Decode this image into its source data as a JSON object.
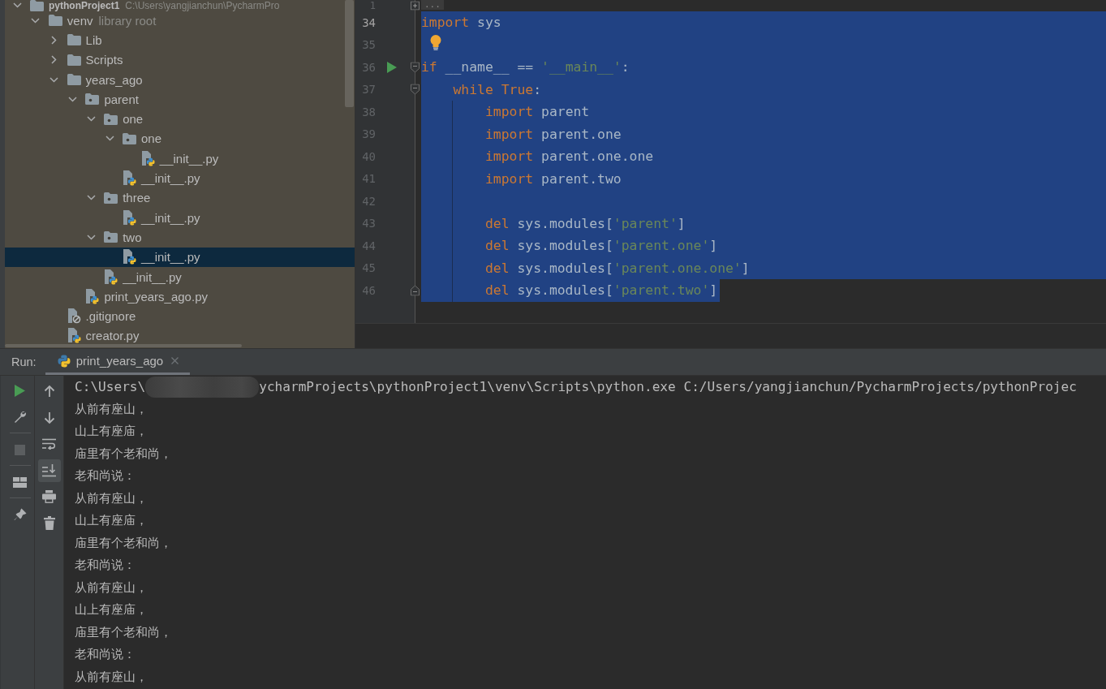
{
  "project_tree": {
    "root": {
      "label": "pythonProject1",
      "path": "C:\\Users\\yangjianchun\\PycharmPro",
      "kind": "project",
      "expanded": true,
      "selected": false,
      "children": [
        {
          "label": "venv",
          "note": "library root",
          "kind": "folder",
          "expanded": true,
          "selected": false,
          "children": [
            {
              "label": "Lib",
              "kind": "folder",
              "expanded": false,
              "selected": false
            },
            {
              "label": "Scripts",
              "kind": "folder",
              "expanded": false,
              "selected": false
            },
            {
              "label": "years_ago",
              "kind": "folder",
              "expanded": true,
              "selected": false,
              "children": [
                {
                  "label": "parent",
                  "kind": "package",
                  "expanded": true,
                  "selected": false,
                  "children": [
                    {
                      "label": "one",
                      "kind": "package",
                      "expanded": true,
                      "selected": false,
                      "children": [
                        {
                          "label": "one",
                          "kind": "package",
                          "expanded": true,
                          "selected": false,
                          "children": [
                            {
                              "label": "__init__.py",
                              "kind": "python",
                              "selected": false
                            }
                          ]
                        },
                        {
                          "label": "__init__.py",
                          "kind": "python",
                          "selected": false
                        }
                      ]
                    },
                    {
                      "label": "three",
                      "kind": "package",
                      "expanded": true,
                      "selected": false,
                      "children": [
                        {
                          "label": "__init__.py",
                          "kind": "python",
                          "selected": false
                        }
                      ]
                    },
                    {
                      "label": "two",
                      "kind": "package",
                      "expanded": true,
                      "selected": false,
                      "children": [
                        {
                          "label": "__init__.py",
                          "kind": "python",
                          "selected": true
                        }
                      ]
                    },
                    {
                      "label": "__init__.py",
                      "kind": "python",
                      "selected": false
                    }
                  ]
                },
                {
                  "label": "print_years_ago.py",
                  "kind": "python",
                  "selected": false
                }
              ]
            },
            {
              "label": ".gitignore",
              "kind": "ignore",
              "selected": false
            },
            {
              "label": "creator.py",
              "kind": "python",
              "selected": false
            }
          ]
        }
      ]
    }
  },
  "editor": {
    "lines": [
      {
        "number": "1",
        "current": false,
        "selected": false,
        "fold": {
          "kind": "folded"
        },
        "folded_text": "..."
      },
      {
        "number": "34",
        "current": true,
        "selected": true,
        "tokens": [
          {
            "text": "import",
            "kind": "keyword"
          },
          {
            "text": " sys",
            "kind": "plain"
          }
        ]
      },
      {
        "number": "35",
        "current": false,
        "selected": true,
        "marker": {
          "kind": "bulb"
        }
      },
      {
        "number": "36",
        "current": false,
        "selected": true,
        "marker": {
          "kind": "run"
        },
        "fold": {
          "kind": "start"
        },
        "tokens": [
          {
            "text": "if",
            "kind": "keyword"
          },
          {
            "text": " __name__ == ",
            "kind": "plain"
          },
          {
            "text": "'__main__'",
            "kind": "string"
          },
          {
            "text": ":",
            "kind": "plain"
          }
        ]
      },
      {
        "number": "37",
        "current": false,
        "selected": true,
        "fold": {
          "kind": "start"
        },
        "tokens": [
          {
            "text": "    while True",
            "kind": "keyword"
          },
          {
            "text": ":",
            "kind": "plain"
          }
        ]
      },
      {
        "number": "38",
        "current": false,
        "selected": true,
        "tokens": [
          {
            "text": "        import",
            "kind": "keyword"
          },
          {
            "text": " parent",
            "kind": "plain"
          }
        ]
      },
      {
        "number": "39",
        "current": false,
        "selected": true,
        "tokens": [
          {
            "text": "        import",
            "kind": "keyword"
          },
          {
            "text": " parent.one",
            "kind": "plain"
          }
        ]
      },
      {
        "number": "40",
        "current": false,
        "selected": true,
        "tokens": [
          {
            "text": "        import",
            "kind": "keyword"
          },
          {
            "text": " parent.one.one",
            "kind": "plain"
          }
        ]
      },
      {
        "number": "41",
        "current": false,
        "selected": true,
        "tokens": [
          {
            "text": "        import",
            "kind": "keyword"
          },
          {
            "text": " parent.two",
            "kind": "plain"
          }
        ]
      },
      {
        "number": "42",
        "current": false,
        "selected": true
      },
      {
        "number": "43",
        "current": false,
        "selected": true,
        "tokens": [
          {
            "text": "        del",
            "kind": "keyword"
          },
          {
            "text": " sys.modules[",
            "kind": "plain"
          },
          {
            "text": "'parent'",
            "kind": "string"
          },
          {
            "text": "]",
            "kind": "plain"
          }
        ]
      },
      {
        "number": "44",
        "current": false,
        "selected": true,
        "tokens": [
          {
            "text": "        del",
            "kind": "keyword"
          },
          {
            "text": " sys.modules[",
            "kind": "plain"
          },
          {
            "text": "'parent.one'",
            "kind": "string"
          },
          {
            "text": "]",
            "kind": "plain"
          }
        ]
      },
      {
        "number": "45",
        "current": false,
        "selected": true,
        "tokens": [
          {
            "text": "        del",
            "kind": "keyword"
          },
          {
            "text": " sys.modules[",
            "kind": "plain"
          },
          {
            "text": "'parent.one.one'",
            "kind": "string"
          },
          {
            "text": "]",
            "kind": "plain"
          }
        ]
      },
      {
        "number": "46",
        "current": false,
        "selected": true,
        "fold": {
          "kind": "end"
        },
        "tokens": [
          {
            "text": "        del",
            "kind": "keyword"
          },
          {
            "text": " sys.modules[",
            "kind": "plain"
          },
          {
            "text": "'parent.two'",
            "kind": "string"
          },
          {
            "text": "]",
            "kind": "plain"
          }
        ]
      }
    ]
  },
  "run_panel": {
    "title": "Run:",
    "tabs": [
      {
        "label": "print_years_ago",
        "selected": true
      }
    ],
    "stop": {
      "disabled": true
    },
    "scroll_to_end": {
      "on": true
    },
    "console": {
      "command": {
        "parts": [
          "C:\\Users\\",
          "ycharmProjects\\pythonProject1\\venv\\Scripts\\python.exe C:/Users/yangjianchun/PycharmProjects/pythonProjec"
        ],
        "redacted": true
      },
      "lines": [
        "从前有座山，",
        "山上有座庙，",
        "庙里有个老和尚，",
        "老和尚说：",
        "从前有座山，",
        "山上有座庙，",
        "庙里有个老和尚，",
        "老和尚说：",
        "从前有座山，",
        "山上有座庙，",
        "庙里有个老和尚，",
        "老和尚说：",
        "从前有座山，"
      ]
    }
  }
}
